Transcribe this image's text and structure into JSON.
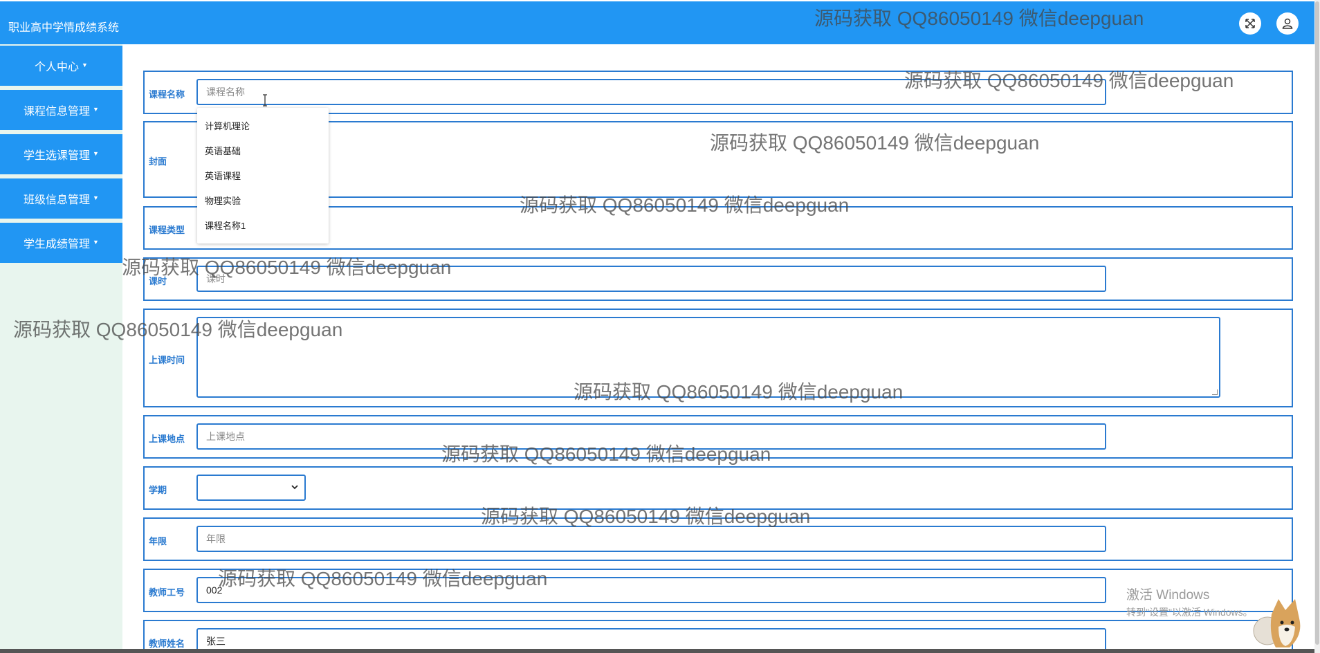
{
  "header": {
    "title": "职业高中学情成绩系统",
    "expand_icon": "expand-icon",
    "user_icon": "user-icon"
  },
  "sidebar": {
    "items": [
      {
        "label": "个人中心"
      },
      {
        "label": "课程信息管理"
      },
      {
        "label": "学生选课管理"
      },
      {
        "label": "班级信息管理"
      },
      {
        "label": "学生成绩管理"
      }
    ],
    "caret": "▼"
  },
  "form": {
    "course_name": {
      "label": "课程名称",
      "placeholder": "课程名称"
    },
    "cover": {
      "label": "封面"
    },
    "course_type": {
      "label": "课程类型"
    },
    "hours": {
      "label": "课时",
      "placeholder": "课时"
    },
    "class_time": {
      "label": "上课时间"
    },
    "location": {
      "label": "上课地点",
      "placeholder": "上课地点"
    },
    "semester": {
      "label": "学期",
      "value": ""
    },
    "years": {
      "label": "年限",
      "placeholder": "年限"
    },
    "teacher_id": {
      "label": "教师工号",
      "value": "002"
    },
    "teacher_name": {
      "label": "教师姓名",
      "value": "张三"
    }
  },
  "autocomplete": {
    "options": [
      "计算机理论",
      "英语基础",
      "英语课程",
      "物理实验",
      "课程名称1"
    ]
  },
  "watermark": "源码获取 QQ86050149 微信deepguan",
  "windows": {
    "line1": "激活 Windows",
    "line2": "转到\"设置\"以激活 Windows。"
  },
  "colors": {
    "primary": "#2196f3",
    "border": "#2a7ad0",
    "sidebar_bg": "#e8f5ee"
  }
}
